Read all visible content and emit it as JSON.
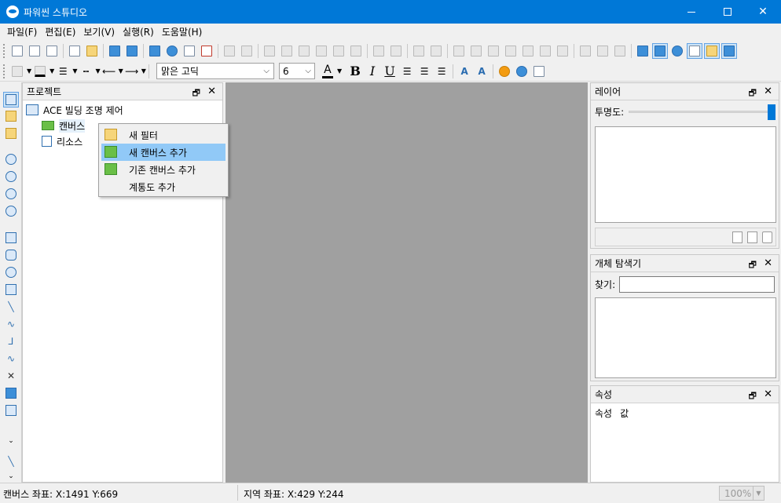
{
  "window": {
    "title": "파워씬 스튜디오"
  },
  "menu": [
    "파일(F)",
    "편집(E)",
    "보기(V)",
    "실행(R)",
    "도움말(H)"
  ],
  "format_toolbar": {
    "font": "맑은 고딕",
    "size": "6",
    "bold": "B",
    "italic": "I",
    "underline": "U",
    "font_color_glyph": "A"
  },
  "project_panel": {
    "title": "프로젝트",
    "tree": {
      "root": "ACE 빌딩 조명 제어",
      "children": [
        "캔버스",
        "리소스"
      ]
    }
  },
  "context_menu": {
    "items": [
      {
        "label": "새 필터",
        "icon": "folder-open-icon"
      },
      {
        "label": "새 캔버스 추가",
        "icon": "new-canvas-icon",
        "highlighted": true
      },
      {
        "label": "기존 캔버스 추가",
        "icon": "existing-canvas-icon"
      },
      {
        "label": "계통도 추가",
        "icon": ""
      }
    ]
  },
  "layer_panel": {
    "title": "레이어",
    "opacity_label": "투명도:",
    "opacity_value": 1.0
  },
  "explorer_panel": {
    "title": "개체 탐색기",
    "find_label": "찾기:",
    "find_value": ""
  },
  "property_panel": {
    "title": "속성",
    "columns": [
      "속성",
      "값"
    ]
  },
  "status": {
    "canvas_coord": "캔버스 좌표: X:1491 Y:669",
    "region_coord": "지역 좌표: X:429 Y:244",
    "zoom": "100%"
  },
  "colors": {
    "titlebar": "#0078d7",
    "canvas_bg": "#a0a0a0",
    "menu_highlight": "#91c9f7"
  }
}
